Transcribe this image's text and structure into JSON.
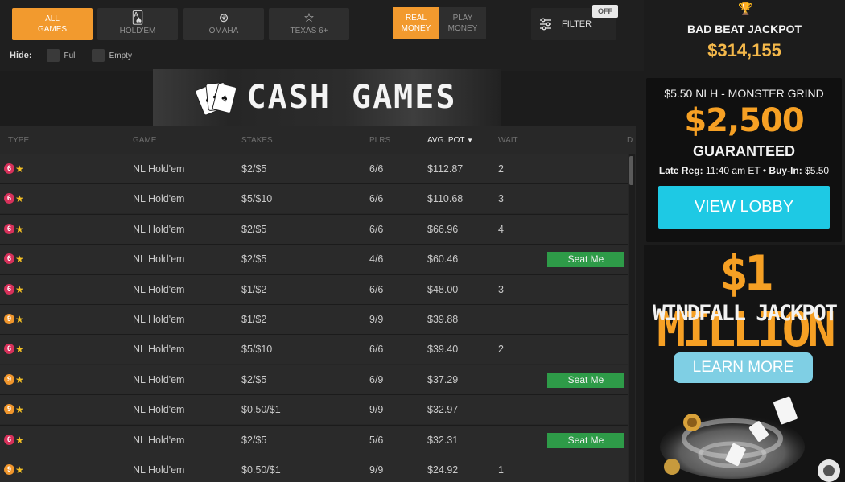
{
  "colors": {
    "accent": "#f29a2e",
    "seat_green": "#2e9b48",
    "cyan": "#1ec9e4",
    "gold": "#f4b84a"
  },
  "tabs": [
    {
      "label": "ALL GAMES",
      "icon": ""
    },
    {
      "label": "HOLD'EM",
      "icon": "cards-icon"
    },
    {
      "label": "OMAHA",
      "icon": "chip-icon"
    },
    {
      "label": "TEXAS 6+",
      "icon": "star-icon"
    }
  ],
  "money_toggle": {
    "real": "REAL MONEY",
    "play": "PLAY MONEY"
  },
  "filter": {
    "label": "FILTER",
    "badge": "OFF"
  },
  "hide": {
    "label": "Hide:",
    "full": "Full",
    "empty": "Empty"
  },
  "banner": {
    "title": "CASH GAMES"
  },
  "table": {
    "headers": [
      "TYPE",
      "GAME",
      "STAKES",
      "PLRS",
      "AVG. POT",
      "WAIT"
    ],
    "sort_column": "AVG. POT",
    "trailing_header": "D",
    "rows": [
      {
        "seats": "6",
        "game": "NL Hold'em",
        "stakes": "$2/$5",
        "plrs": "6/6",
        "pot": "$112.87",
        "wait": "2",
        "seat_me": ""
      },
      {
        "seats": "6",
        "game": "NL Hold'em",
        "stakes": "$5/$10",
        "plrs": "6/6",
        "pot": "$110.68",
        "wait": "3",
        "seat_me": ""
      },
      {
        "seats": "6",
        "game": "NL Hold'em",
        "stakes": "$2/$5",
        "plrs": "6/6",
        "pot": "$66.96",
        "wait": "4",
        "seat_me": ""
      },
      {
        "seats": "6",
        "game": "NL Hold'em",
        "stakes": "$2/$5",
        "plrs": "4/6",
        "pot": "$60.46",
        "wait": "",
        "seat_me": "Seat Me"
      },
      {
        "seats": "6",
        "game": "NL Hold'em",
        "stakes": "$1/$2",
        "plrs": "6/6",
        "pot": "$48.00",
        "wait": "3",
        "seat_me": ""
      },
      {
        "seats": "9",
        "game": "NL Hold'em",
        "stakes": "$1/$2",
        "plrs": "9/9",
        "pot": "$39.88",
        "wait": "",
        "seat_me": ""
      },
      {
        "seats": "6",
        "game": "NL Hold'em",
        "stakes": "$5/$10",
        "plrs": "6/6",
        "pot": "$39.40",
        "wait": "2",
        "seat_me": ""
      },
      {
        "seats": "9",
        "game": "NL Hold'em",
        "stakes": "$2/$5",
        "plrs": "6/9",
        "pot": "$37.29",
        "wait": "",
        "seat_me": "Seat Me"
      },
      {
        "seats": "9",
        "game": "NL Hold'em",
        "stakes": "$0.50/$1",
        "plrs": "9/9",
        "pot": "$32.97",
        "wait": "",
        "seat_me": ""
      },
      {
        "seats": "6",
        "game": "NL Hold'em",
        "stakes": "$2/$5",
        "plrs": "5/6",
        "pot": "$32.31",
        "wait": "",
        "seat_me": "Seat Me"
      },
      {
        "seats": "9",
        "game": "NL Hold'em",
        "stakes": "$0.50/$1",
        "plrs": "9/9",
        "pot": "$24.92",
        "wait": "1",
        "seat_me": ""
      }
    ]
  },
  "jackpot": {
    "title": "BAD BEAT JACKPOT",
    "amount": "$314,155"
  },
  "promo_tournament": {
    "name": "$5.50 NLH - MONSTER GRIND",
    "amount": "$2,500",
    "guaranteed": "GUARANTEED",
    "late_reg_label": "Late Reg:",
    "late_reg_time": "11:40 am ET",
    "separator": "•",
    "buyin_label": "Buy-In:",
    "buyin_value": "$5.50",
    "button": "VIEW LOBBY"
  },
  "promo_windfall": {
    "headline": "$1 MILLION",
    "subline": "WINDFALL JACKPOT",
    "button": "LEARN MORE"
  }
}
